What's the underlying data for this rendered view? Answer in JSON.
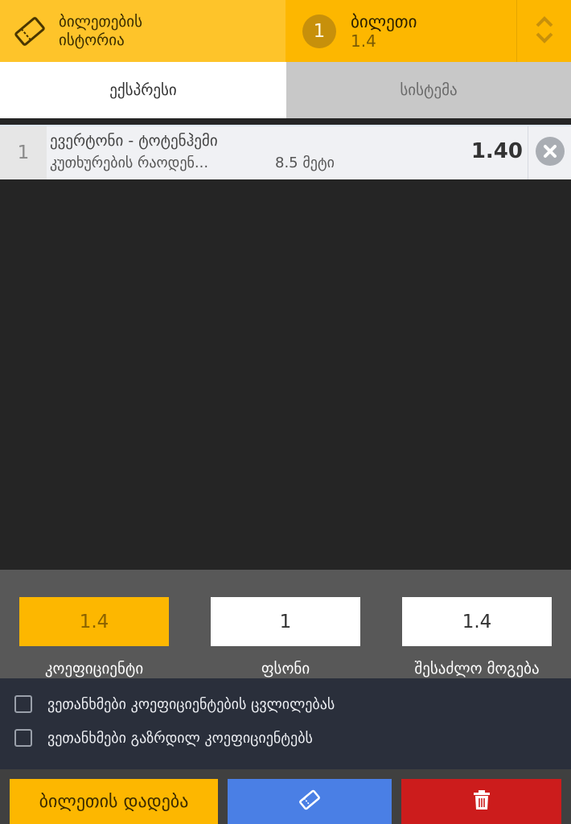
{
  "header": {
    "history_label": "ბილეთების\nისტორია",
    "ticket_count": "1",
    "ticket_title": "ბილეთი",
    "ticket_odds": "1.4"
  },
  "tabs": {
    "express": "ექსპრესი",
    "system": "სისტემა"
  },
  "bet": {
    "index": "1",
    "match": "ევერტონი - ტოტენჰემი",
    "market": "კუთხურების რაოდენ...",
    "selection": "8.5 მეტი",
    "odd": "1.40"
  },
  "calc": {
    "coefficient_value": "1.4",
    "coefficient_label": "კოეფიციენტი",
    "stake_value": "1",
    "stake_label": "ფსონი",
    "win_value": "1.4",
    "win_label": "შესაძლო მოგება"
  },
  "options": {
    "accept_changes": "ვეთანხმები კოეფიციენტების ცვლილებას",
    "accept_boosted": "ვეთანხმები გაზრდილ კოეფიციენტებს"
  },
  "actions": {
    "place_label": "ბილეთის დადება"
  },
  "colors": {
    "history_bg": "#FEC42A",
    "ticket_bg": "#FDB700",
    "share_button": "#4A7FE5",
    "clear_button": "#CC1C1C"
  },
  "icons": {
    "history": "ticket-icon",
    "toggle": "chevron-up-down-icon",
    "remove": "close-icon",
    "share": "ticket-icon",
    "clear": "trash-icon"
  }
}
